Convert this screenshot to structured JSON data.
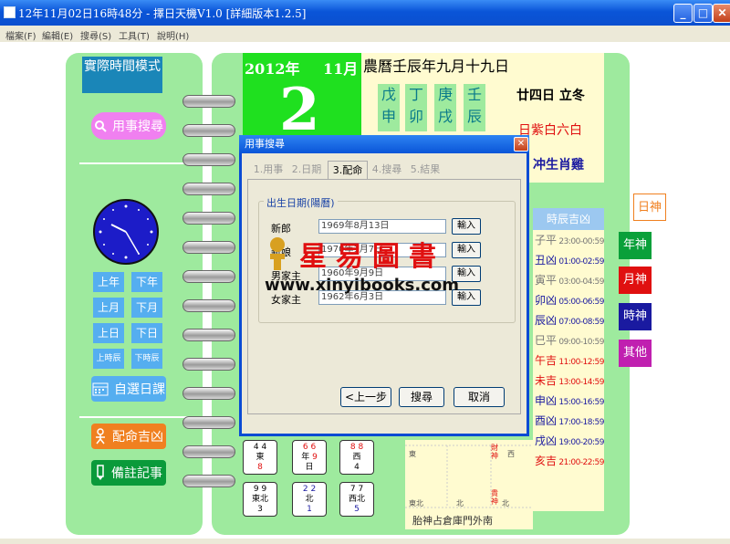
{
  "window": {
    "title": "12年11月02日16時48分 - 擇日天機V1.0 [詳細版本1.2.5]"
  },
  "menu": [
    "檔案(F)",
    "編輯(E)",
    "搜尋(S)",
    "工具(T)",
    "說明(H)"
  ],
  "left": {
    "mode": "實際時間模式",
    "search_button": "用事搜尋",
    "nav": [
      "上年",
      "下年",
      "上月",
      "下月",
      "上日",
      "下日",
      "上時辰",
      "下時辰"
    ],
    "custom_button": "自選日課",
    "match_button": "配命吉凶",
    "notes_button": "備註記事"
  },
  "calendar": {
    "year": "2012年",
    "month": "11月",
    "day": "2",
    "lunar": "農曆壬辰年九月十九日",
    "ganzhi": [
      "戊申",
      "丁卯",
      "庚戌",
      "壬辰"
    ],
    "solar_term": "廿四日 立冬",
    "star": "日紫白六白",
    "clash": "冲生肖雞",
    "hour_header": "時辰吉凶",
    "hours": [
      {
        "label": "子平",
        "time": "23:00-00:59"
      },
      {
        "label": "丑凶",
        "time": "01:00-02:59"
      },
      {
        "label": "寅平",
        "time": "03:00-04:59"
      },
      {
        "label": "卯凶",
        "time": "05:00-06:59"
      },
      {
        "label": "辰凶",
        "time": "07:00-08:59"
      },
      {
        "label": "巳平",
        "time": "09:00-10:59"
      },
      {
        "label": "午吉",
        "time": "11:00-12:59"
      },
      {
        "label": "未吉",
        "time": "13:00-14:59"
      },
      {
        "label": "申凶",
        "time": "15:00-16:59"
      },
      {
        "label": "酉凶",
        "time": "17:00-18:59"
      },
      {
        "label": "戌凶",
        "time": "19:00-20:59"
      },
      {
        "label": "亥吉",
        "time": "21:00-22:59"
      }
    ],
    "side_tabs": [
      "日神",
      "年神",
      "月神",
      "時神",
      "其他"
    ],
    "grid_top": [
      {
        "n1": "4",
        "n2": "4",
        "dir": "東",
        "n3": "8"
      },
      {
        "n1": "6",
        "n2": "6",
        "dir": "年",
        "n3": "9",
        "extra": "日"
      },
      {
        "n1": "8",
        "n2": "8",
        "dir": "西",
        "n3": "4"
      }
    ],
    "grid_bottom": [
      {
        "n1": "9",
        "n2": "9",
        "dir": "東北",
        "n3": "3"
      },
      {
        "n1": "2",
        "n2": "2",
        "dir": "北",
        "n3": "1"
      },
      {
        "n1": "7",
        "n2": "7",
        "dir": "西北",
        "n3": "5"
      }
    ],
    "compass": {
      "east": "東",
      "west": "西",
      "north": "北",
      "northeast": "東北",
      "caishen": "財神",
      "guishen": "貴神",
      "fetal": "胎神占倉庫門外南"
    }
  },
  "dialog": {
    "title": "用事搜尋",
    "tabs": [
      "1.用事",
      "2.日期",
      "3.配命",
      "4.搜尋",
      "5.結果"
    ],
    "group_label": "出生日期(陽曆)",
    "rows": [
      {
        "label": "新郎",
        "value": "1969年8月13日",
        "button": "輸入"
      },
      {
        "label": "新娘",
        "value": "1970年1月7日",
        "button": "輸入"
      },
      {
        "label": "男家主",
        "value": "1960年9月9日",
        "button": "輸入"
      },
      {
        "label": "女家主",
        "value": "1962年6月3日",
        "button": "輸入"
      }
    ],
    "buttons": [
      "<上一步",
      "搜尋",
      "取消"
    ]
  },
  "watermark": {
    "brand": "星易圖書",
    "url": "www.xinyibooks.com"
  },
  "colors": {
    "panel_green": "#9eea9e",
    "date_green": "#1fe01f",
    "cream": "#fffbd0",
    "title_blue": "#0a55d8",
    "red": "#e01010",
    "pink": "#f080f0",
    "orange": "#f08020"
  }
}
